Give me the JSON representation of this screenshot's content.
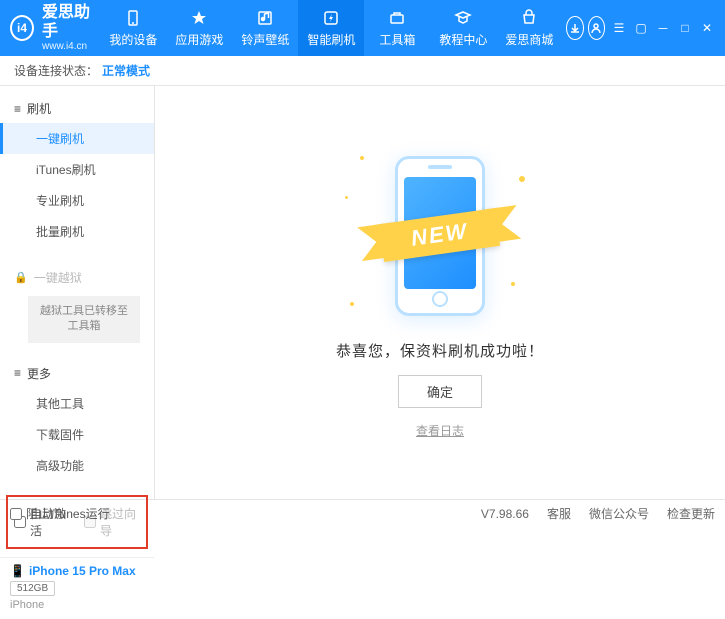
{
  "app": {
    "name": "爱思助手",
    "url": "www.i4.cn"
  },
  "nav": {
    "items": [
      {
        "label": "我的设备"
      },
      {
        "label": "应用游戏"
      },
      {
        "label": "铃声壁纸"
      },
      {
        "label": "智能刷机"
      },
      {
        "label": "工具箱"
      },
      {
        "label": "教程中心"
      },
      {
        "label": "爱思商城"
      }
    ]
  },
  "status": {
    "prefix": "设备连接状态：",
    "mode": "正常模式"
  },
  "sidebar": {
    "flash": {
      "head": "刷机",
      "items": [
        "一键刷机",
        "iTunes刷机",
        "专业刷机",
        "批量刷机"
      ]
    },
    "jailbreak": {
      "head": "一键越狱",
      "note": "越狱工具已转移至工具箱"
    },
    "more": {
      "head": "更多",
      "items": [
        "其他工具",
        "下载固件",
        "高级功能"
      ]
    },
    "options": {
      "auto_activate": "自动激活",
      "skip_guide": "跳过向导"
    }
  },
  "device": {
    "name": "iPhone 15 Pro Max",
    "capacity": "512GB",
    "type": "iPhone"
  },
  "main": {
    "ribbon": "NEW",
    "message": "恭喜您，保资料刷机成功啦！",
    "ok": "确定",
    "log": "查看日志"
  },
  "footer": {
    "block_itunes": "阻止iTunes运行",
    "version": "V7.98.66",
    "links": [
      "客服",
      "微信公众号",
      "检查更新"
    ]
  }
}
